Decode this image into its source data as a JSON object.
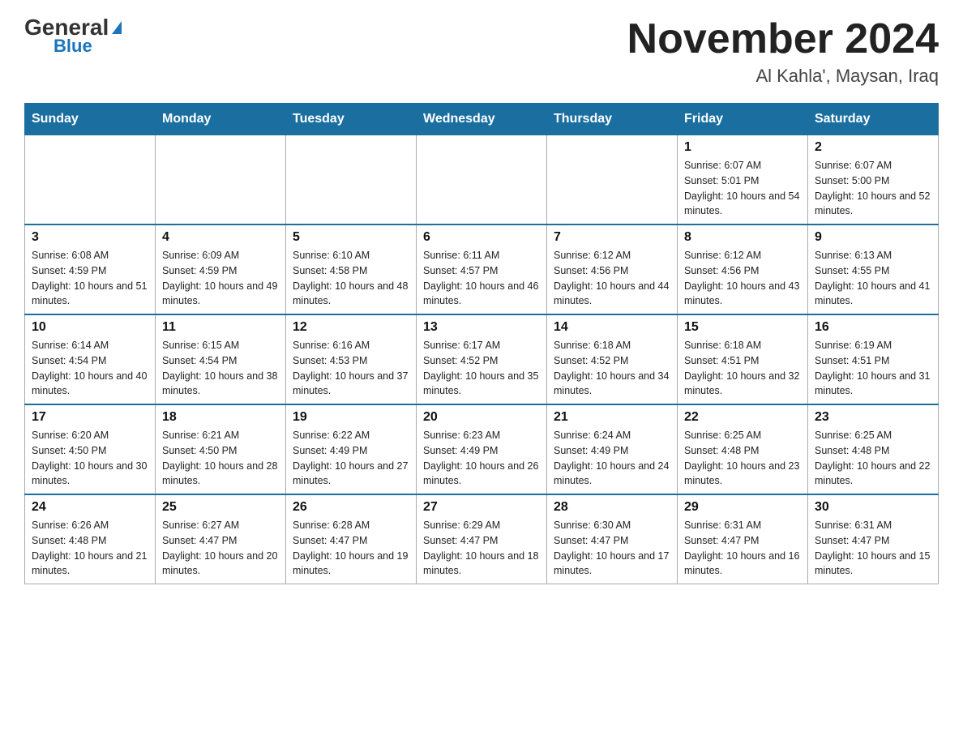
{
  "header": {
    "logo_general": "General",
    "logo_blue": "Blue",
    "month_title": "November 2024",
    "location": "Al Kahla', Maysan, Iraq"
  },
  "days_of_week": [
    "Sunday",
    "Monday",
    "Tuesday",
    "Wednesday",
    "Thursday",
    "Friday",
    "Saturday"
  ],
  "weeks": [
    [
      {
        "day": "",
        "info": ""
      },
      {
        "day": "",
        "info": ""
      },
      {
        "day": "",
        "info": ""
      },
      {
        "day": "",
        "info": ""
      },
      {
        "day": "",
        "info": ""
      },
      {
        "day": "1",
        "info": "Sunrise: 6:07 AM\nSunset: 5:01 PM\nDaylight: 10 hours and 54 minutes."
      },
      {
        "day": "2",
        "info": "Sunrise: 6:07 AM\nSunset: 5:00 PM\nDaylight: 10 hours and 52 minutes."
      }
    ],
    [
      {
        "day": "3",
        "info": "Sunrise: 6:08 AM\nSunset: 4:59 PM\nDaylight: 10 hours and 51 minutes."
      },
      {
        "day": "4",
        "info": "Sunrise: 6:09 AM\nSunset: 4:59 PM\nDaylight: 10 hours and 49 minutes."
      },
      {
        "day": "5",
        "info": "Sunrise: 6:10 AM\nSunset: 4:58 PM\nDaylight: 10 hours and 48 minutes."
      },
      {
        "day": "6",
        "info": "Sunrise: 6:11 AM\nSunset: 4:57 PM\nDaylight: 10 hours and 46 minutes."
      },
      {
        "day": "7",
        "info": "Sunrise: 6:12 AM\nSunset: 4:56 PM\nDaylight: 10 hours and 44 minutes."
      },
      {
        "day": "8",
        "info": "Sunrise: 6:12 AM\nSunset: 4:56 PM\nDaylight: 10 hours and 43 minutes."
      },
      {
        "day": "9",
        "info": "Sunrise: 6:13 AM\nSunset: 4:55 PM\nDaylight: 10 hours and 41 minutes."
      }
    ],
    [
      {
        "day": "10",
        "info": "Sunrise: 6:14 AM\nSunset: 4:54 PM\nDaylight: 10 hours and 40 minutes."
      },
      {
        "day": "11",
        "info": "Sunrise: 6:15 AM\nSunset: 4:54 PM\nDaylight: 10 hours and 38 minutes."
      },
      {
        "day": "12",
        "info": "Sunrise: 6:16 AM\nSunset: 4:53 PM\nDaylight: 10 hours and 37 minutes."
      },
      {
        "day": "13",
        "info": "Sunrise: 6:17 AM\nSunset: 4:52 PM\nDaylight: 10 hours and 35 minutes."
      },
      {
        "day": "14",
        "info": "Sunrise: 6:18 AM\nSunset: 4:52 PM\nDaylight: 10 hours and 34 minutes."
      },
      {
        "day": "15",
        "info": "Sunrise: 6:18 AM\nSunset: 4:51 PM\nDaylight: 10 hours and 32 minutes."
      },
      {
        "day": "16",
        "info": "Sunrise: 6:19 AM\nSunset: 4:51 PM\nDaylight: 10 hours and 31 minutes."
      }
    ],
    [
      {
        "day": "17",
        "info": "Sunrise: 6:20 AM\nSunset: 4:50 PM\nDaylight: 10 hours and 30 minutes."
      },
      {
        "day": "18",
        "info": "Sunrise: 6:21 AM\nSunset: 4:50 PM\nDaylight: 10 hours and 28 minutes."
      },
      {
        "day": "19",
        "info": "Sunrise: 6:22 AM\nSunset: 4:49 PM\nDaylight: 10 hours and 27 minutes."
      },
      {
        "day": "20",
        "info": "Sunrise: 6:23 AM\nSunset: 4:49 PM\nDaylight: 10 hours and 26 minutes."
      },
      {
        "day": "21",
        "info": "Sunrise: 6:24 AM\nSunset: 4:49 PM\nDaylight: 10 hours and 24 minutes."
      },
      {
        "day": "22",
        "info": "Sunrise: 6:25 AM\nSunset: 4:48 PM\nDaylight: 10 hours and 23 minutes."
      },
      {
        "day": "23",
        "info": "Sunrise: 6:25 AM\nSunset: 4:48 PM\nDaylight: 10 hours and 22 minutes."
      }
    ],
    [
      {
        "day": "24",
        "info": "Sunrise: 6:26 AM\nSunset: 4:48 PM\nDaylight: 10 hours and 21 minutes."
      },
      {
        "day": "25",
        "info": "Sunrise: 6:27 AM\nSunset: 4:47 PM\nDaylight: 10 hours and 20 minutes."
      },
      {
        "day": "26",
        "info": "Sunrise: 6:28 AM\nSunset: 4:47 PM\nDaylight: 10 hours and 19 minutes."
      },
      {
        "day": "27",
        "info": "Sunrise: 6:29 AM\nSunset: 4:47 PM\nDaylight: 10 hours and 18 minutes."
      },
      {
        "day": "28",
        "info": "Sunrise: 6:30 AM\nSunset: 4:47 PM\nDaylight: 10 hours and 17 minutes."
      },
      {
        "day": "29",
        "info": "Sunrise: 6:31 AM\nSunset: 4:47 PM\nDaylight: 10 hours and 16 minutes."
      },
      {
        "day": "30",
        "info": "Sunrise: 6:31 AM\nSunset: 4:47 PM\nDaylight: 10 hours and 15 minutes."
      }
    ]
  ]
}
